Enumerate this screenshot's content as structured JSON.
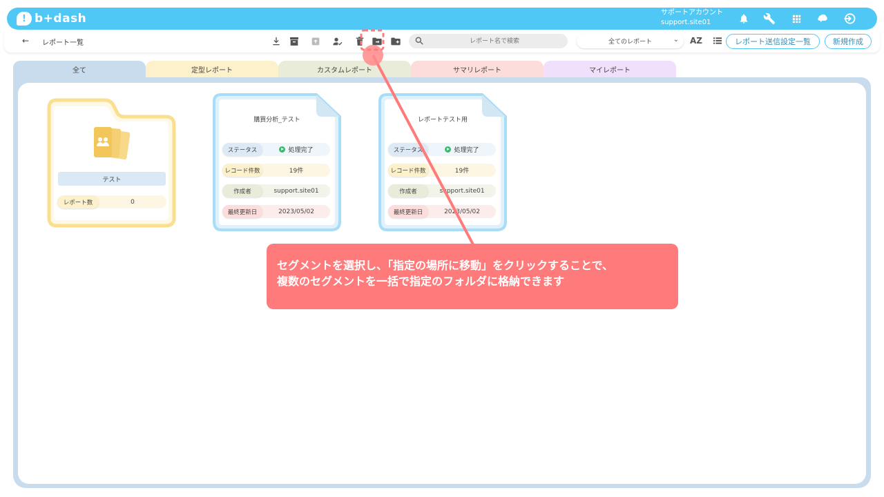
{
  "header": {
    "logo_text": "b+dash",
    "account_label": "サポートアカウント",
    "account_id": "support.site01",
    "icons": [
      "bell-icon",
      "wrench-icon",
      "grid-icon",
      "brain-icon",
      "logout-icon"
    ]
  },
  "toolbar": {
    "back_icon": "arrow-left-icon",
    "breadcrumb": "レポート一覧",
    "search_placeholder": "レポート名で検索",
    "filter_selected": "全てのレポート",
    "sort_label": "AZ",
    "send_settings_label": "レポート送信設定一覧",
    "new_label": "新規作成"
  },
  "tabs": [
    {
      "label": "全て",
      "color": "#c9dcee"
    },
    {
      "label": "定型レポート",
      "color": "#fdf1cc"
    },
    {
      "label": "カスタムレポート",
      "color": "#e8ecd8"
    },
    {
      "label": "サマリレポート",
      "color": "#fddcdc"
    },
    {
      "label": "マイレポート",
      "color": "#f0e0fb"
    }
  ],
  "folder": {
    "name": "テスト",
    "count_label": "レポート数",
    "count_value": "0"
  },
  "reports": [
    {
      "title": "購買分析_テスト",
      "status_label": "ステータス",
      "status_value": "処理完了",
      "records_label": "レコード件数",
      "records_value": "19件",
      "author_label": "作成者",
      "author_value": "support.site01",
      "updated_label": "最終更新日",
      "updated_value": "2023/05/02"
    },
    {
      "title": "レポートテスト用",
      "status_label": "ステータス",
      "status_value": "処理完了",
      "records_label": "レコード件数",
      "records_value": "19件",
      "author_label": "作成者",
      "author_value": "support.site01",
      "updated_label": "最終更新日",
      "updated_value": "2023/05/02"
    }
  ],
  "callout": {
    "line1": "セグメントを選択し、「指定の場所に移動」をクリックすることで、",
    "line2": "複数のセグメントを一括で指定のフォルダに格納できます"
  },
  "colors": {
    "brand": "#4fc8f5",
    "folder_border": "#fadf8f",
    "report_border": "#a9dcf6",
    "callout": "#ff7b7b"
  }
}
